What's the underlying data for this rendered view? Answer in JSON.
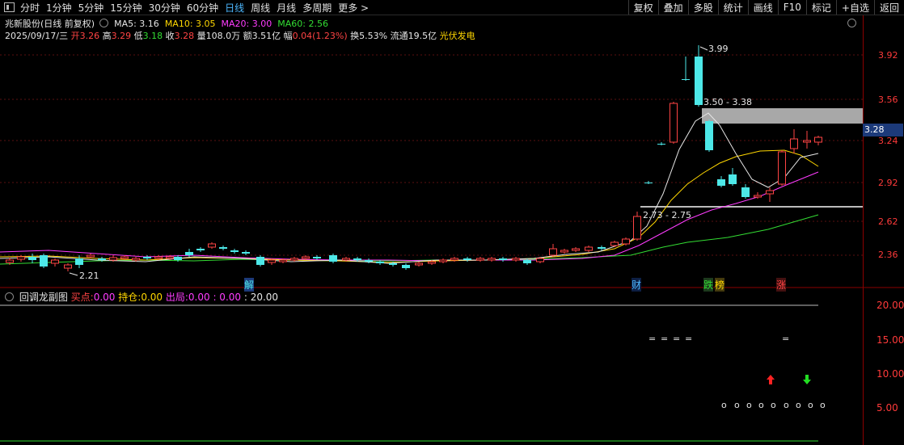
{
  "toolbar": {
    "periods": [
      "分时",
      "1分钟",
      "5分钟",
      "15分钟",
      "30分钟",
      "60分钟",
      "日线",
      "周线",
      "月线",
      "多周期",
      "更多"
    ],
    "active_period": "日线",
    "more_arrow": ">",
    "right_buttons": [
      "复权",
      "叠加",
      "多股",
      "统计",
      "画线",
      "F10",
      "标记",
      "+自选",
      "返回"
    ]
  },
  "stock": {
    "name": "兆新股份(日线 前复权)",
    "ma5_label": "MA5: 3.16",
    "ma10_label": "MA10: 3.05",
    "ma20_label": "MA20: 3.00",
    "ma60_label": "MA60: 2.56",
    "date": "2025/09/17/三",
    "open_label": "开",
    "open": "3.26",
    "high_label": "高",
    "high": "3.29",
    "low_label": "低",
    "low": "3.18",
    "close_label": "收",
    "close": "3.28",
    "volume_label": "量",
    "volume": "108.0万",
    "amount_label": "额",
    "amount": "3.51亿",
    "change_label": "幅",
    "change": "0.04(1.23%)",
    "turnover_label": "换",
    "turnover": "5.53%",
    "float_label": "流通",
    "float": "19.5亿",
    "sector": "光伏发电"
  },
  "colors": {
    "ma5": "#e6e6e6",
    "ma10": "#ffd700",
    "ma20": "#ff3cff",
    "ma60": "#33dd33",
    "up": "#ff4444",
    "down": "#4de8e8",
    "axis": "#ff3a3a"
  },
  "price_axis": [
    "3.92",
    "3.56",
    "3.24",
    "2.92",
    "2.62",
    "2.36"
  ],
  "current_price": "3.28",
  "annotations": {
    "high_label": "3.99",
    "upper_zone": "3.50 - 3.38",
    "lower_zone": "2.73 - 2.75",
    "low_label": "2.21"
  },
  "events": [
    {
      "text": "解",
      "color": "#4de8e8",
      "bg": "#1c3a7a"
    },
    {
      "text": "财",
      "color": "#4db8ff",
      "bg": "#0d1f44"
    },
    {
      "text": "跌",
      "color": "#33dd33",
      "bg": "#1c3a1c"
    },
    {
      "text": "榜",
      "color": "#ffd700",
      "bg": "#443a0d"
    },
    {
      "text": "涨",
      "color": "#ff4444",
      "bg": "#441010"
    }
  ],
  "sub_indicator": {
    "name": "回调龙副图",
    "buy_label": "买点:",
    "buy": "0.00",
    "hold_label": "持仓:",
    "hold": "0.00",
    "exit_label": "出局:",
    "exit": "0.00",
    "extra1": ": 0.00",
    "extra2": ": 20.00",
    "axis": [
      "20.00",
      "15.00",
      "10.00",
      "5.00"
    ],
    "dash_marks": [
      "=",
      "=",
      "=",
      "=",
      "="
    ],
    "circle_mark": "o"
  }
}
